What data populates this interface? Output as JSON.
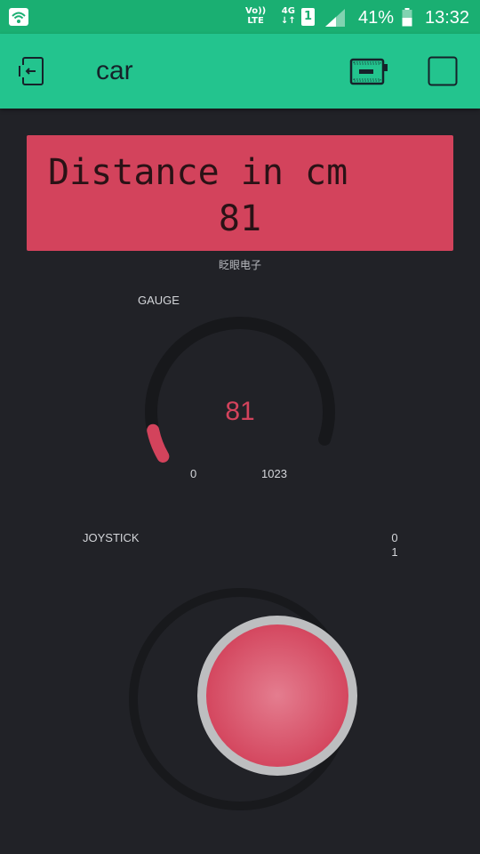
{
  "status_bar": {
    "volte_top": "Vo))",
    "volte_bottom": "LTE",
    "network": "4G",
    "network_arrows": "↓↑",
    "sim_slot": "1",
    "battery_percent": "41%",
    "time": "13:32",
    "icons": [
      "wifi-icon",
      "volte-icon",
      "sim-icon",
      "signal-icon",
      "battery-icon"
    ]
  },
  "app_bar": {
    "title": "car",
    "icons": [
      "exit-icon",
      "device-icon",
      "play-icon"
    ]
  },
  "lcd": {
    "line1": "Distance in cm",
    "line2": "81",
    "label": "眨眼电子",
    "color": "#d3435c"
  },
  "gauge": {
    "label": "GAUGE",
    "value": "81",
    "min": "0",
    "max": "1023",
    "fill_fraction": 0.079,
    "color": "#d3435c"
  },
  "joystick": {
    "label": "JOYSTICK",
    "x_value": "0",
    "y_value": "1",
    "color": "#d3435c"
  },
  "colors": {
    "status_bar": "#1aaf72",
    "app_bar": "#23c48e",
    "background": "#212227",
    "accent": "#d3435c"
  }
}
